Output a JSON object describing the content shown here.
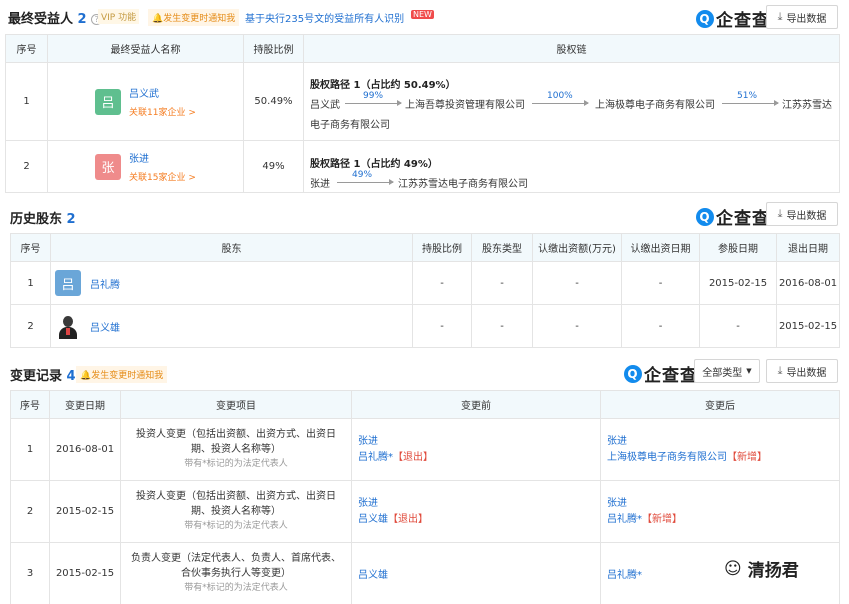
{
  "beneficiaries": {
    "title": "最终受益人",
    "count": "2",
    "vip_tag": "VIP 功能",
    "notify_tag": "发生变更时通知我",
    "rule_link": "基于央行235号文的受益所有人识别",
    "new_badge": "NEW",
    "export_label": "导出数据",
    "logo_text": "企查查",
    "columns": [
      "序号",
      "最终受益人名称",
      "持股比例",
      "股权链"
    ],
    "rows": [
      {
        "index": "1",
        "avatar_char": "吕",
        "avatar_color": "#5fbf8f",
        "name": "吕义武",
        "related": "关联11家企业 >",
        "ratio": "50.49%",
        "path_title": "股权路径 1（占比约 50.49%）",
        "chain": [
          {
            "node": "吕义武"
          },
          {
            "pct": "99%"
          },
          {
            "node": "上海吾尊投资管理有限公司"
          },
          {
            "pct": "100%"
          },
          {
            "node": "上海极尊电子商务有限公司"
          },
          {
            "pct": "51%"
          },
          {
            "node": "江苏苏雪达"
          }
        ],
        "chain_tail": "电子商务有限公司"
      },
      {
        "index": "2",
        "avatar_char": "张",
        "avatar_color": "#ef8b8b",
        "name": "张进",
        "related": "关联15家企业 >",
        "ratio": "49%",
        "path_title": "股权路径 1（占比约 49%）",
        "chain": [
          {
            "node": "张进"
          },
          {
            "pct": "49%"
          },
          {
            "node": "江苏苏雪达电子商务有限公司"
          }
        ]
      }
    ]
  },
  "history": {
    "title": "历史股东",
    "count": "2",
    "export_label": "导出数据",
    "logo_text": "企查查",
    "columns": [
      "序号",
      "股东",
      "持股比例",
      "股东类型",
      "认缴出资额(万元)",
      "认缴出资日期",
      "参股日期",
      "退出日期"
    ],
    "rows": [
      {
        "index": "1",
        "avatar_char": "吕",
        "name": "吕礼腾",
        "ratio": "-",
        "type": "-",
        "amount": "-",
        "sub_date": "-",
        "join_date": "2015-02-15",
        "exit_date": "2016-08-01"
      },
      {
        "index": "2",
        "name": "吕义雄",
        "ratio": "-",
        "type": "-",
        "amount": "-",
        "sub_date": "-",
        "join_date": "-",
        "exit_date": "2015-02-15"
      }
    ]
  },
  "changes": {
    "title": "变更记录",
    "count": "4",
    "notify_tag": "发生变更时通知我",
    "logo_text": "企查查",
    "filter_label": "全部类型",
    "export_label": "导出数据",
    "columns": [
      "序号",
      "变更日期",
      "变更项目",
      "变更前",
      "变更后"
    ],
    "rows": [
      {
        "index": "1",
        "date": "2016-08-01",
        "item": "投资人变更（包括出资额、出资方式、出资日期、投资人名称等）",
        "note": "带有*标记的为法定代表人",
        "before": [
          {
            "name": "张进",
            "mark": ""
          },
          {
            "name": "吕礼腾*",
            "mark": "【退出】"
          }
        ],
        "after": [
          {
            "name": "张进",
            "mark": ""
          },
          {
            "name": "上海极尊电子商务有限公司",
            "mark": "【新增】"
          }
        ]
      },
      {
        "index": "2",
        "date": "2015-02-15",
        "item": "投资人变更（包括出资额、出资方式、出资日期、投资人名称等）",
        "note": "带有*标记的为法定代表人",
        "before": [
          {
            "name": "张进",
            "mark": ""
          },
          {
            "name": "吕义雄",
            "mark": "【退出】"
          }
        ],
        "after": [
          {
            "name": "张进",
            "mark": ""
          },
          {
            "name": "吕礼腾*",
            "mark": "【新增】"
          }
        ]
      },
      {
        "index": "3",
        "date": "2015-02-15",
        "item": "负责人变更（法定代表人、负责人、首席代表、合伙事务执行人等变更）",
        "note": "带有*标记的为法定代表人",
        "before": [
          {
            "name": "吕义雄",
            "mark": ""
          }
        ],
        "after": [
          {
            "name": "吕礼腾*",
            "mark": ""
          }
        ]
      }
    ]
  },
  "watermark": "清扬君"
}
